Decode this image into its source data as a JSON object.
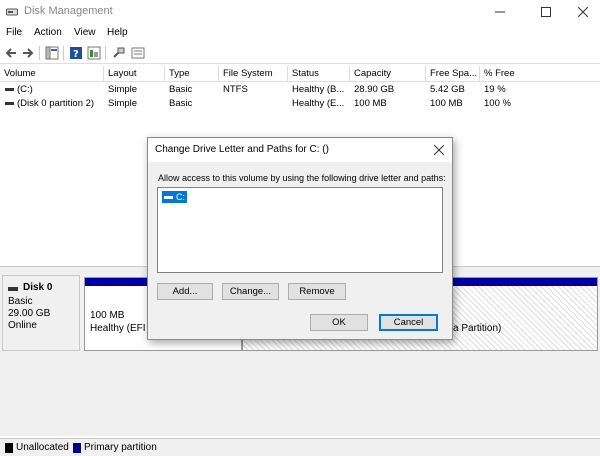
{
  "window": {
    "title": "Disk Management",
    "icon": "disk-management-icon"
  },
  "menu": [
    "File",
    "Action",
    "View",
    "Help"
  ],
  "toolbar": {
    "icons": [
      "back-arrow-icon",
      "forward-arrow-icon",
      "console-tree-icon",
      "help-icon",
      "properties-icon",
      "connect-icon",
      "console-icon"
    ]
  },
  "volumes": {
    "columns": [
      "Volume",
      "Layout",
      "Type",
      "File System",
      "Status",
      "Capacity",
      "Free Spa...",
      "% Free"
    ],
    "rows": [
      [
        "(C:)",
        "Simple",
        "Basic",
        "NTFS",
        "Healthy (B...",
        "28.90 GB",
        "5.42 GB",
        "19 %"
      ],
      [
        "(Disk 0 partition 2)",
        "Simple",
        "Basic",
        "",
        "Healthy (E...",
        "100 MB",
        "100 MB",
        "100 %"
      ]
    ]
  },
  "disk": {
    "name": "Disk 0",
    "type": "Basic",
    "size": "29.00 GB",
    "status": "Online",
    "partitions": [
      {
        "size": "100 MB",
        "status": "Healthy (EFI S"
      },
      {
        "status": "a Partition)"
      }
    ]
  },
  "legend": [
    {
      "label": "Unallocated",
      "color": "#000000"
    },
    {
      "label": "Primary partition",
      "color": "#00008b"
    }
  ],
  "dialog": {
    "title": "Change Drive Letter and Paths for C: ()",
    "description": "Allow access to this volume by using the following drive letter and paths:",
    "list_items": [
      "C:"
    ],
    "buttons": {
      "add": "Add...",
      "change": "Change...",
      "remove": "Remove",
      "ok": "OK",
      "cancel": "Cancel"
    }
  },
  "colors": {
    "primary_partition": "#0000a0",
    "selection": "#0078d7"
  }
}
